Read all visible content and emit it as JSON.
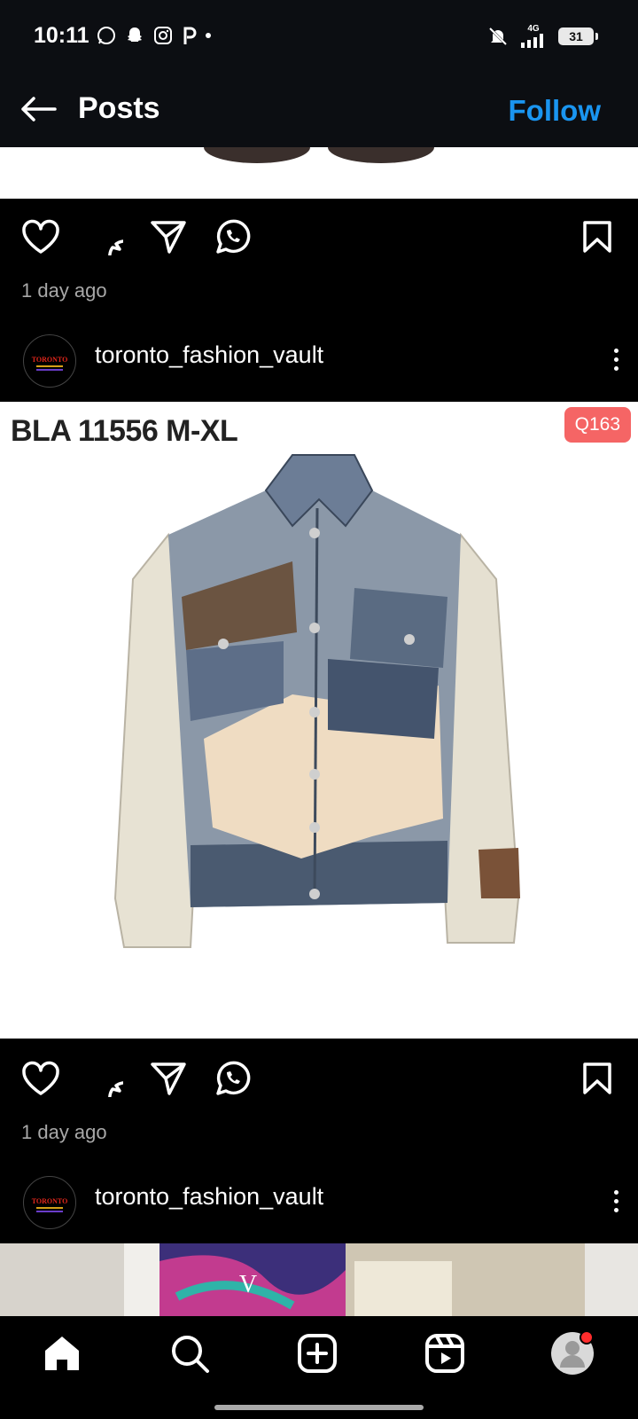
{
  "status_bar": {
    "time": "10:11",
    "network": "4G",
    "battery": "31"
  },
  "header": {
    "title": "Posts",
    "follow_label": "Follow"
  },
  "posts": [
    {
      "timestamp": "1 day ago"
    },
    {
      "author": "toronto_fashion_vault",
      "avatar_text": "TORONTO",
      "image_title": "BLA 11556 M-XL",
      "price_tag": "Q163",
      "timestamp": "1 day ago"
    },
    {
      "author": "toronto_fashion_vault",
      "avatar_text": "TORONTO"
    }
  ],
  "colors": {
    "accent": "#1a95f0",
    "price_tag": "#f56565",
    "notification_dot": "#ff2d2d"
  },
  "icons": [
    "back-arrow-icon",
    "heart-icon",
    "comment-icon",
    "share-icon",
    "whatsapp-icon",
    "bookmark-icon",
    "home-icon",
    "search-icon",
    "create-icon",
    "reels-icon",
    "profile-icon"
  ]
}
